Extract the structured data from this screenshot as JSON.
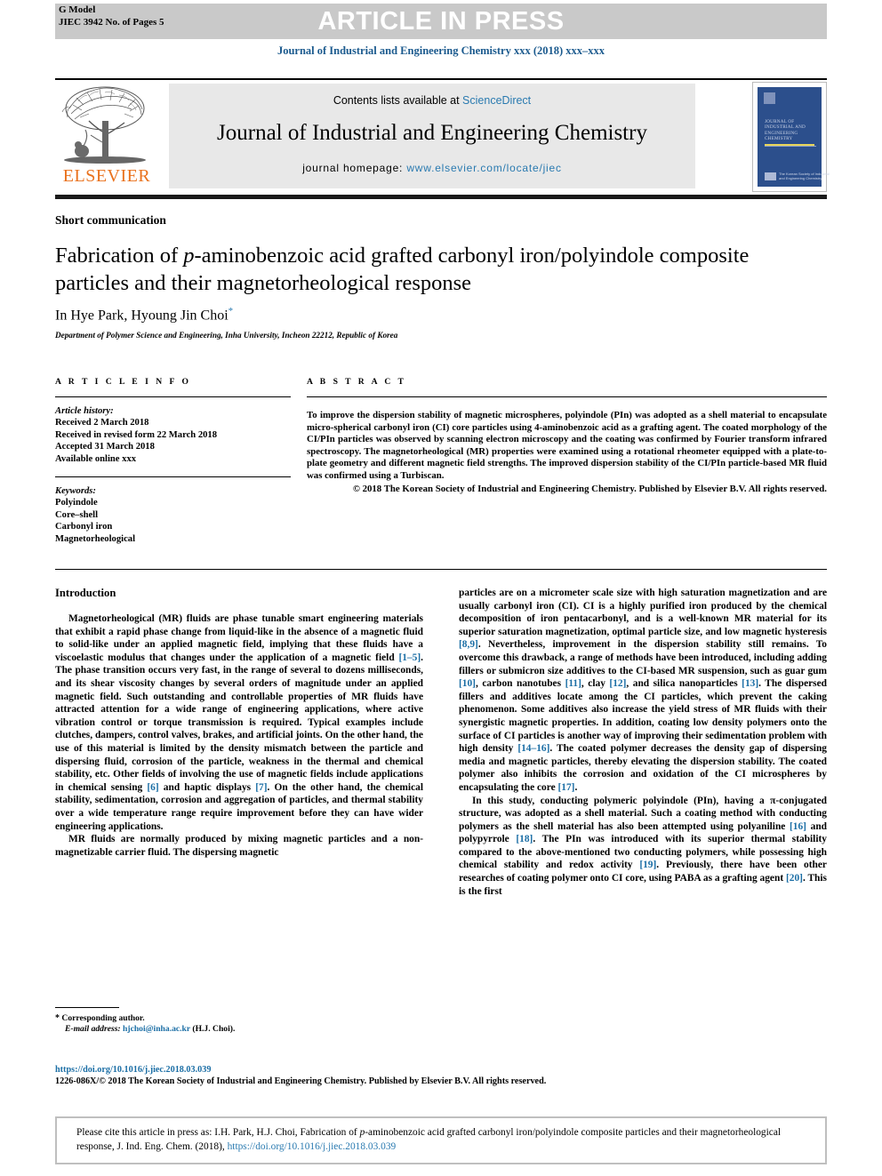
{
  "header": {
    "g_model": "G Model",
    "pages_line": "JIEC 3942 No. of Pages 5",
    "article_in_press": "ARTICLE IN PRESS",
    "journal_ref_line": "Journal of Industrial and Engineering Chemistry xxx (2018) xxx–xxx"
  },
  "masthead": {
    "contents_prefix": "Contents lists available at ",
    "contents_link": "ScienceDirect",
    "journal_title": "Journal of Industrial and Engineering Chemistry",
    "homepage_prefix": "journal homepage: ",
    "homepage_url": "www.elsevier.com/locate/jiec",
    "publisher_wordmark": "ELSEVIER",
    "cover_title": "JOURNAL OF INDUSTRIAL AND ENGINEERING CHEMISTRY",
    "cover_society": "The Korean Society of Industrial and Engineering Chemistry"
  },
  "article": {
    "type": "Short communication",
    "title_line1_pre": "Fabrication of ",
    "title_italic": "p",
    "title_line1_post": "-aminobenzoic acid grafted carbonyl iron/polyindole",
    "title_line2": "composite particles and their magnetorheological response",
    "authors": "In Hye Park, Hyoung Jin Choi",
    "author_star": "*",
    "affiliation": "Department of Polymer Science and Engineering, Inha University, Incheon 22212, Republic of Korea"
  },
  "article_info": {
    "heading": "A R T I C L E   I N F O",
    "history_label": "Article history:",
    "history": [
      "Received 2 March 2018",
      "Received in revised form 22 March 2018",
      "Accepted 31 March 2018",
      "Available online xxx"
    ],
    "keywords_label": "Keywords:",
    "keywords": [
      "Polyindole",
      "Core–shell",
      "Carbonyl iron",
      "Magnetorheological"
    ]
  },
  "abstract": {
    "heading": "A B S T R A C T",
    "text": "To improve the dispersion stability of magnetic microspheres, polyindole (PIn) was adopted as a shell material to encapsulate micro-spherical carbonyl iron (CI) core particles using 4-aminobenzoic acid as a grafting agent. The coated morphology of the CI/PIn particles was observed by scanning electron microscopy and the coating was confirmed by Fourier transform infrared spectroscopy. The magnetorheological (MR) properties were examined using a rotational rheometer equipped with a plate-to-plate geometry and different magnetic field strengths. The improved dispersion stability of the CI/PIn particle-based MR fluid was confirmed using a Turbiscan.",
    "copyright": "© 2018 The Korean Society of Industrial and Engineering Chemistry. Published by Elsevier B.V. All rights reserved."
  },
  "body": {
    "intro_heading": "Introduction",
    "left_paragraphs": [
      "Magnetorheological (MR) fluids are phase tunable smart engineering materials that exhibit a rapid phase change from liquid-like in the absence of a magnetic fluid to solid-like under an applied magnetic field, implying that these fluids have a viscoelastic modulus that changes under the application of a magnetic field [1–5]. The phase transition occurs very fast, in the range of several to dozens milliseconds, and its shear viscosity changes by several orders of magnitude under an applied magnetic field. Such outstanding and controllable properties of MR fluids have attracted attention for a wide range of engineering applications, where active vibration control or torque transmission is required. Typical examples include clutches, dampers, control valves, brakes, and artificial joints. On the other hand, the use of this material is limited by the density mismatch between the particle and dispersing fluid, corrosion of the particle, weakness in the thermal and chemical stability, etc. Other fields of involving the use of magnetic fields include applications in chemical sensing [6] and haptic displays [7]. On the other hand, the chemical stability, sedimentation, corrosion and aggregation of particles, and thermal stability over a wide temperature range require improvement before they can have wider engineering applications.",
      "MR fluids are normally produced by mixing magnetic particles and a non-magnetizable carrier fluid. The dispersing magnetic"
    ],
    "right_paragraphs": [
      "particles are on a micrometer scale size with high saturation magnetization and are usually carbonyl iron (CI). CI is a highly purified iron produced by the chemical decomposition of iron pentacarbonyl, and is a well-known MR material for its superior saturation magnetization, optimal particle size, and low magnetic hysteresis [8,9]. Nevertheless, improvement in the dispersion stability still remains. To overcome this drawback, a range of methods have been introduced, including adding fillers or submicron size additives to the CI-based MR suspension, such as guar gum [10], carbon nanotubes [11], clay [12], and silica nanoparticles [13]. The dispersed fillers and additives locate among the CI particles, which prevent the caking phenomenon. Some additives also increase the yield stress of MR fluids with their synergistic magnetic properties. In addition, coating low density polymers onto the surface of CI particles is another way of improving their sedimentation problem with high density [14–16]. The coated polymer decreases the density gap of dispersing media and magnetic particles, thereby elevating the dispersion stability. The coated polymer also inhibits the corrosion and oxidation of the CI microspheres by encapsulating the core [17].",
      "In this study, conducting polymeric polyindole (PIn), having a π-conjugated structure, was adopted as a shell material. Such a coating method with conducting polymers as the shell material has also been attempted using polyaniline [16] and polypyrrole [18]. The PIn was introduced with its superior thermal stability compared to the above-mentioned two conducting polymers, while possessing high chemical stability and redox activity [19]. Previously, there have been other researches of coating polymer onto CI core, using PABA as a grafting agent [20]. This is the first"
    ]
  },
  "footnotes": {
    "corresponding_star": "*",
    "corresponding_label": "Corresponding author.",
    "email_label": "E-mail address:",
    "email": "hjchoi@inha.ac.kr",
    "email_suffix": "(H.J. Choi)."
  },
  "footer": {
    "doi": "https://doi.org/10.1016/j.jiec.2018.03.039",
    "issn_line": "1226-086X/© 2018 The Korean Society of Industrial and Engineering Chemistry. Published by Elsevier B.V. All rights reserved."
  },
  "citation_box": {
    "prefix": "Please cite this article in press as: I.H. Park, H.J. Choi, Fabrication of ",
    "italic": "p",
    "mid": "-aminobenzoic acid grafted carbonyl iron/polyindole composite particles and their magnetorheological response, J. Ind. Eng. Chem. (2018), ",
    "link": "https://doi.org/10.1016/j.jiec.2018.03.039"
  },
  "colors": {
    "link_blue": "#2a7ab0",
    "ref_blue": "#1b6ea5",
    "band_gray": "#c9c9c9",
    "elsevier_orange": "#E9711C",
    "cover_blue": "#2c4f8c"
  }
}
